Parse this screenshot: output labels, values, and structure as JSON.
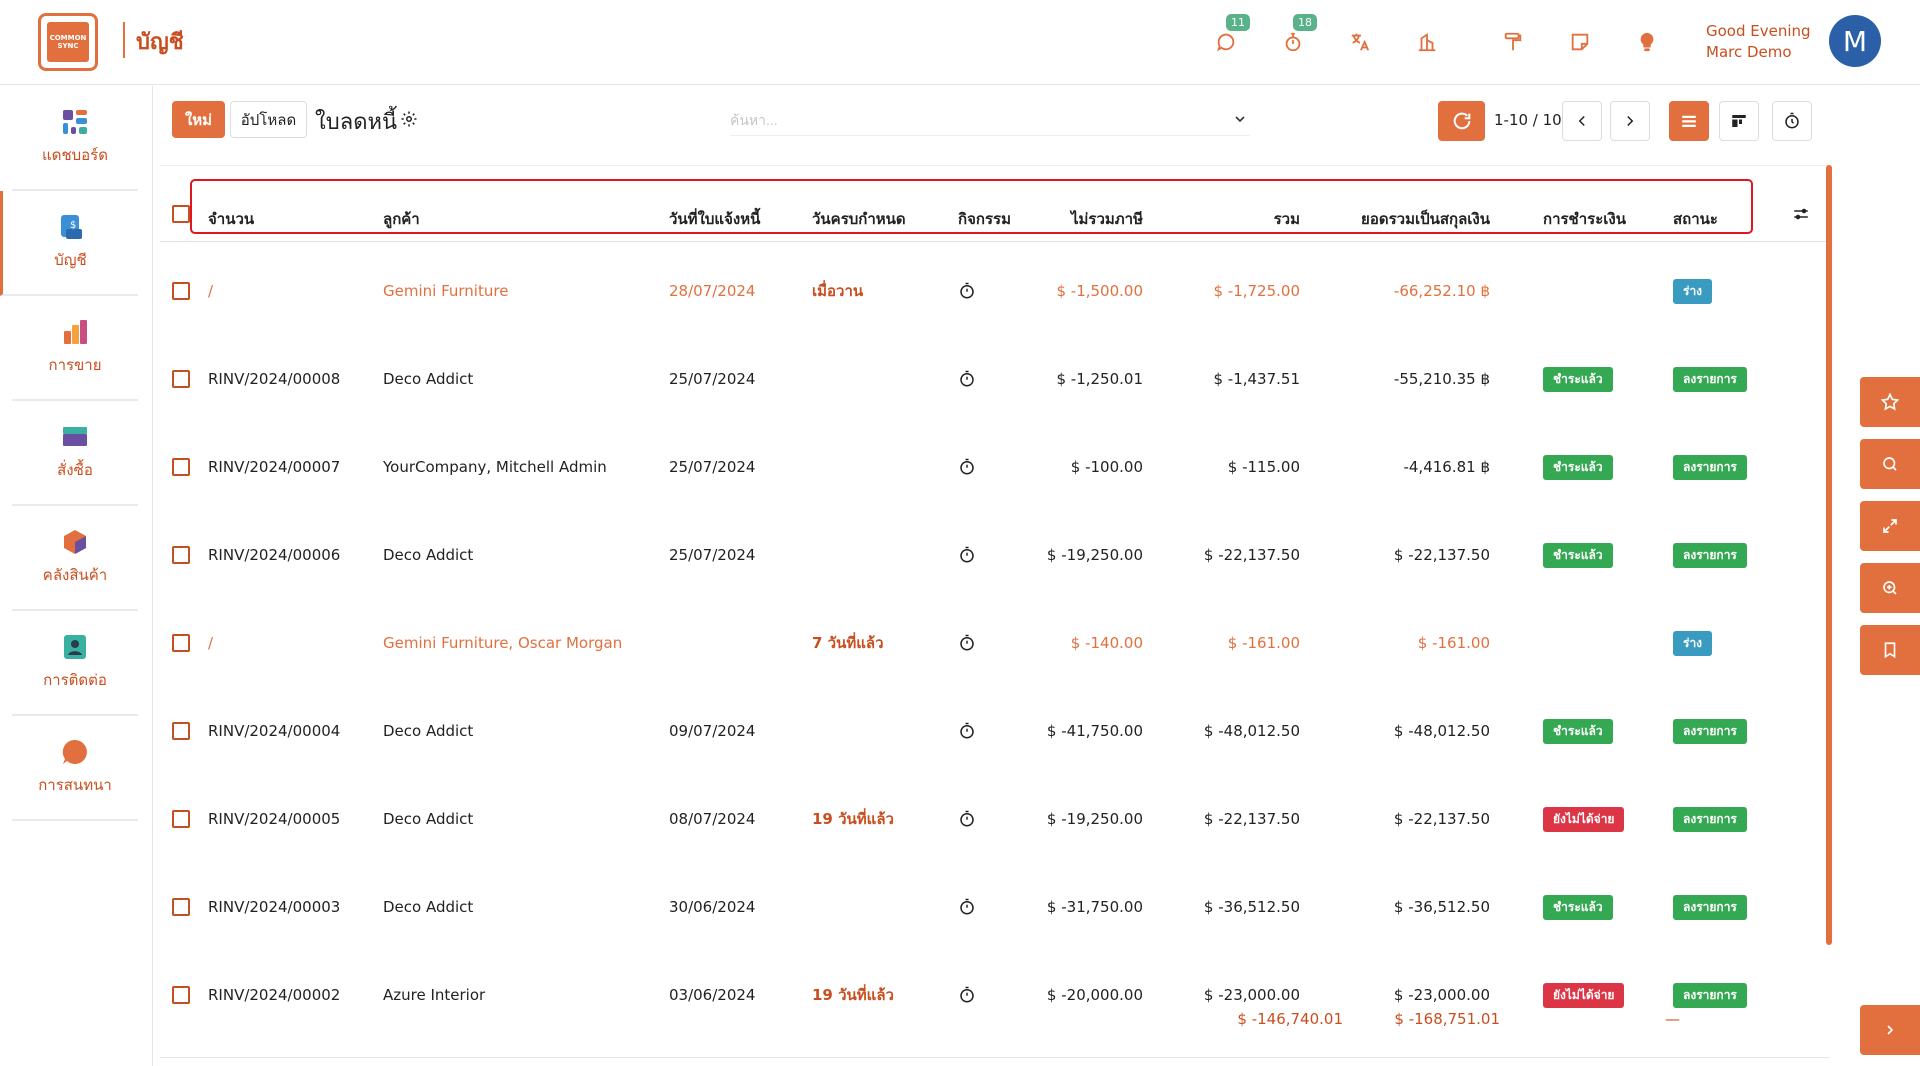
{
  "app": {
    "logo_text": "COMMON SYNC",
    "title": "บัญชี",
    "greeting_line1": "Good Evening",
    "greeting_line2": "Marc Demo",
    "avatar_initial": "M",
    "accent_color": "#e2703f"
  },
  "topbar": {
    "chat_badge": "11",
    "activity_badge": "18"
  },
  "sidebar": {
    "items": [
      {
        "label": "แดชบอร์ด",
        "icon": "dashboard-icon"
      },
      {
        "label": "บัญชี",
        "icon": "accounting-icon"
      },
      {
        "label": "การขาย",
        "icon": "sales-icon"
      },
      {
        "label": "สั่งซื้อ",
        "icon": "purchase-icon"
      },
      {
        "label": "คลังสินค้า",
        "icon": "inventory-icon"
      },
      {
        "label": "การติดต่อ",
        "icon": "contacts-icon"
      },
      {
        "label": "การสนทนา",
        "icon": "discuss-icon"
      }
    ]
  },
  "control": {
    "new_label": "ใหม่",
    "upload_label": "อัปโหลด",
    "breadcrumb": "ใบลดหนี้",
    "search_placeholder": "ค้นหา...",
    "pager": "1-10 / 10"
  },
  "table": {
    "headers": {
      "number": "จำนวน",
      "customer": "ลูกค้า",
      "invoice_date": "วันที่ใบแจ้งหนี้",
      "due_date": "วันครบกำหนด",
      "activity": "กิจกรรม",
      "untaxed": "ไม่รวมภาษี",
      "total": "รวม",
      "total_currency": "ยอดรวมเป็นสกุลเงิน",
      "payment": "การชำระเงิน",
      "status": "สถานะ"
    },
    "rows": [
      {
        "number": "/",
        "customer": "Gemini Furniture",
        "invoice_date": "28/07/2024",
        "due_date": "เมื่อวาน",
        "untaxed": "$ -1,500.00",
        "total": "$ -1,725.00",
        "total_currency": "-66,252.10 ฿",
        "payment": "",
        "status": "ร่าง",
        "draft": true
      },
      {
        "number": "RINV/2024/00008",
        "customer": "Deco Addict",
        "invoice_date": "25/07/2024",
        "due_date": "",
        "untaxed": "$ -1,250.01",
        "total": "$ -1,437.51",
        "total_currency": "-55,210.35 ฿",
        "payment": "ชำระแล้ว",
        "status": "ลงรายการ",
        "draft": false
      },
      {
        "number": "RINV/2024/00007",
        "customer": "YourCompany, Mitchell Admin",
        "invoice_date": "25/07/2024",
        "due_date": "",
        "untaxed": "$ -100.00",
        "total": "$ -115.00",
        "total_currency": "-4,416.81 ฿",
        "payment": "ชำระแล้ว",
        "status": "ลงรายการ",
        "draft": false
      },
      {
        "number": "RINV/2024/00006",
        "customer": "Deco Addict",
        "invoice_date": "25/07/2024",
        "due_date": "",
        "untaxed": "$ -19,250.00",
        "total": "$ -22,137.50",
        "total_currency": "$ -22,137.50",
        "payment": "ชำระแล้ว",
        "status": "ลงรายการ",
        "draft": false
      },
      {
        "number": "/",
        "customer": "Gemini Furniture, Oscar Morgan",
        "invoice_date": "",
        "due_date": "7 วันที่แล้ว",
        "untaxed": "$ -140.00",
        "total": "$ -161.00",
        "total_currency": "$ -161.00",
        "payment": "",
        "status": "ร่าง",
        "draft": true
      },
      {
        "number": "RINV/2024/00004",
        "customer": "Deco Addict",
        "invoice_date": "09/07/2024",
        "due_date": "",
        "untaxed": "$ -41,750.00",
        "total": "$ -48,012.50",
        "total_currency": "$ -48,012.50",
        "payment": "ชำระแล้ว",
        "status": "ลงรายการ",
        "draft": false
      },
      {
        "number": "RINV/2024/00005",
        "customer": "Deco Addict",
        "invoice_date": "08/07/2024",
        "due_date": "19 วันที่แล้ว",
        "untaxed": "$ -19,250.00",
        "total": "$ -22,137.50",
        "total_currency": "$ -22,137.50",
        "payment": "ยังไม่ได้จ่าย",
        "status": "ลงรายการ",
        "draft": false
      },
      {
        "number": "RINV/2024/00003",
        "customer": "Deco Addict",
        "invoice_date": "30/06/2024",
        "due_date": "",
        "untaxed": "$ -31,750.00",
        "total": "$ -36,512.50",
        "total_currency": "$ -36,512.50",
        "payment": "ชำระแล้ว",
        "status": "ลงรายการ",
        "draft": false
      },
      {
        "number": "RINV/2024/00002",
        "customer": "Azure Interior",
        "invoice_date": "03/06/2024",
        "due_date": "19 วันที่แล้ว",
        "untaxed": "$ -20,000.00",
        "total": "$ -23,000.00",
        "total_currency": "$ -23,000.00",
        "payment": "ยังไม่ได้จ่าย",
        "status": "ลงรายการ",
        "draft": false
      }
    ],
    "totals": {
      "untaxed": "$ -146,740.01",
      "total": "$ -168,751.01",
      "total_currency": "—"
    }
  }
}
